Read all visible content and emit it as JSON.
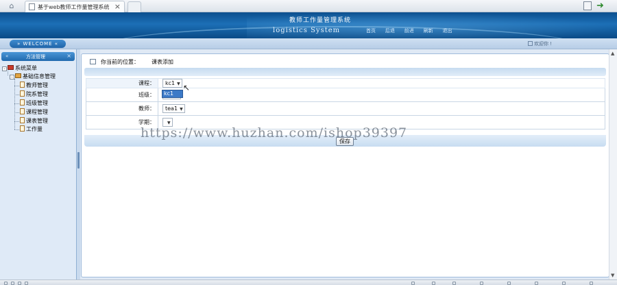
{
  "browser": {
    "tab_title": "基于web教师工作量管理系统",
    "tab_close": "×",
    "home_icon": "home-icon",
    "toolbar_icons": [
      "page-icon",
      "back-arrow-icon"
    ]
  },
  "banner": {
    "title": "教师工作量管理系统",
    "subtitle": "logistics System",
    "nav": [
      "首页",
      "后退",
      "前进",
      "刷新",
      "退出"
    ]
  },
  "strip": {
    "welcome": "» WELCOME «",
    "greeting": "欢迎你 !"
  },
  "sidebar": {
    "header": "方法管理",
    "tree": {
      "root": "系统菜单",
      "group": "基础信息管理",
      "items": [
        "教师管理",
        "院系管理",
        "班级管理",
        "课程管理",
        "课表管理",
        "工作量"
      ]
    }
  },
  "main": {
    "position_label": "你当前的位置：",
    "position_value": "课表添加",
    "form": {
      "course_label": "课程：",
      "course_value": "kc1",
      "course_dropdown_option": "kc1",
      "class_label": "班级：",
      "class_value": "bj1",
      "teacher_label": "教师：",
      "teacher_value": "tea1",
      "term_label": "学期：",
      "term_value": ""
    },
    "save_label": "保存"
  },
  "watermark": "https://www.huzhan.com/ishop39397",
  "colors": {
    "banner": "#1c6fb6",
    "accent": "#216aae",
    "dropdown_highlight": "#3b79c7"
  }
}
